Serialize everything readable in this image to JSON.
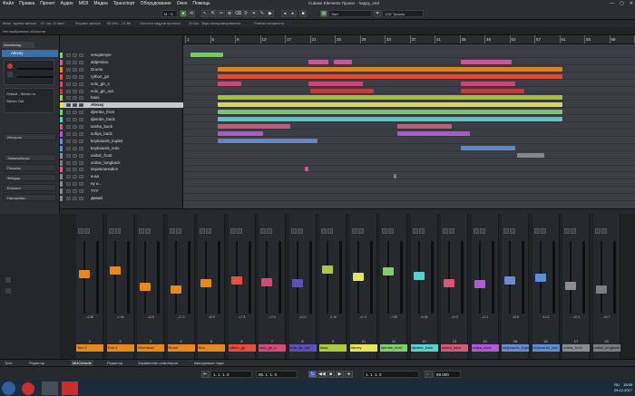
{
  "window": {
    "title": "Cubase Elements Проект - happy_end",
    "menu": [
      "Файл",
      "Правка",
      "Проект",
      "Аудио",
      "MIDI",
      "Медиа",
      "Транспорт",
      "Оборудование",
      "Окно",
      "Помощь"
    ],
    "controls": [
      "—",
      "▢",
      "✕"
    ]
  },
  "toolbar": {
    "mode": "M · S",
    "grid": "Такт",
    "quantize": "1/32 Триоль"
  },
  "info_line": {
    "items": [
      "Макс. время записи",
      "61 час 13 мин",
      "Формат записи",
      "96 kHz - 24 Bit",
      "Частота кадров проекта",
      "30 fps",
      "Звук панорамирования",
      "Равная мощность"
    ]
  },
  "status": "Нет выбранных объектов",
  "inspector": {
    "tab": "Инспектор",
    "track": "Alexey",
    "input": "Левый - Stereo In",
    "output": "Stereo Out",
    "sections": [
      "Инсерты",
      "Эквалайзеры",
      "Посылы",
      "Фейдер",
      "Блокнот",
      "Настройки"
    ],
    "colors": {
      "yellow": "#e6e45a",
      "green": "#6fcf5a",
      "blue": "#5b8fd6",
      "purple": "#8b6ab8",
      "cyan": "#5ccfd0"
    }
  },
  "tracks": [
    {
      "name": "vetuplenyie",
      "color": "#7fd06a"
    },
    {
      "name": "didjeridoo",
      "color": "#d65aa0"
    },
    {
      "name": "Drums",
      "color": "#e8891e"
    },
    {
      "name": "rython_gtr",
      "color": "#e84e3a"
    },
    {
      "name": "solo_gtr_s",
      "color": "#d64a7a"
    },
    {
      "name": "solo_gtr_out",
      "color": "#c93c3c"
    },
    {
      "name": "bass",
      "color": "#aec93c"
    },
    {
      "name": "Alexey",
      "color": "#e6e45a"
    },
    {
      "name": "djembe_front",
      "color": "#7fd06a"
    },
    {
      "name": "djembe_back",
      "color": "#5ccfd0"
    },
    {
      "name": "sasha_back",
      "color": "#d65a78"
    },
    {
      "name": "sofiya_back",
      "color": "#b45ad6"
    },
    {
      "name": "keyboards_kuplet",
      "color": "#6a8ad6"
    },
    {
      "name": "keyboards_solo",
      "color": "#5b8fd6"
    },
    {
      "name": "unitaz_front",
      "color": "#8a8e94"
    },
    {
      "name": "unitaz_longback",
      "color": "#7a7e84"
    },
    {
      "name": "переключайся",
      "color": "#d65aa0"
    },
    {
      "name": "а-аа",
      "color": "#888"
    },
    {
      "name": "ну и...",
      "color": "#888"
    },
    {
      "name": "ТУУ",
      "color": "#888"
    },
    {
      "name": "Давай",
      "color": "#888"
    }
  ],
  "ruler": [
    "1",
    "5",
    "9",
    "13",
    "17",
    "21",
    "25",
    "29",
    "33",
    "37",
    "41",
    "45",
    "49",
    "53",
    "57",
    "61",
    "65",
    "69",
    "73"
  ],
  "mixer": {
    "channels": [
      {
        "num": "1",
        "label": "Tom 2",
        "color": "#e8891e",
        "val": "-3.56",
        "level": 0.55
      },
      {
        "num": "2",
        "label": "Tom 4",
        "color": "#e8891e",
        "val": "-1.06",
        "level": 0.6
      },
      {
        "num": "3",
        "label": "Overhead",
        "color": "#e8891e",
        "val": "-12.8",
        "level": 0.35
      },
      {
        "num": "4",
        "label": "Room",
        "color": "#e8891e",
        "val": "-17.3",
        "level": 0.3
      },
      {
        "num": "5",
        "label": "Bus",
        "color": "#e8891e",
        "val": "-13.9",
        "level": 0.4
      },
      {
        "num": "6",
        "label": "rython_gtr",
        "color": "#e84e3a",
        "val": "-17.8",
        "level": 0.45
      },
      {
        "num": "7",
        "label": "solo_gtr_s",
        "color": "#d64a7a",
        "val": "-17.6",
        "level": 0.42
      },
      {
        "num": "8",
        "label": "solo_gtr_out",
        "color": "#5b4fb8",
        "val": "-12.0",
        "level": 0.4
      },
      {
        "num": "9",
        "label": "bass",
        "color": "#aec93c",
        "val": "-9.15",
        "level": 0.62
      },
      {
        "num": "10",
        "label": "Alexey",
        "color": "#e6e45a",
        "val": "-6.71",
        "level": 0.5
      },
      {
        "num": "11",
        "label": "djembe_front",
        "color": "#7fd06a",
        "val": "-7.65",
        "level": 0.58
      },
      {
        "num": "12",
        "label": "djembe_back",
        "color": "#5ccfd0",
        "val": "-6.35",
        "level": 0.52
      },
      {
        "num": "13",
        "label": "sasha_back",
        "color": "#d65a78",
        "val": "-12.0",
        "level": 0.4
      },
      {
        "num": "14",
        "label": "sofiya_back",
        "color": "#b45ad6",
        "val": "-12.1",
        "level": 0.38
      },
      {
        "num": "15",
        "label": "keyboards_kuplet",
        "color": "#6a8ad6",
        "val": "-13.5",
        "level": 0.45
      },
      {
        "num": "16",
        "label": "keyboards_solo",
        "color": "#5b8fd6",
        "val": "-11.6",
        "level": 0.48
      },
      {
        "num": "17",
        "label": "unitaz_front",
        "color": "#8a8e94",
        "val": "-12.4",
        "level": 0.36
      },
      {
        "num": "18",
        "label": "unitaz_longback",
        "color": "#7a7e84",
        "val": "-24.7",
        "level": 0.3
      }
    ]
  },
  "bottom_tabs": [
    "Трек",
    "Редактор",
    "MixConsole",
    "Редактор",
    "Управление семплером",
    "Аккордовые пэды"
  ],
  "transport": {
    "left_locator": "1. 1. 1. 0",
    "right_locator": "65. 1. 1. 0",
    "position": "1. 1. 1. 0",
    "tempo": "89.000"
  },
  "clock": {
    "time": "15:55",
    "date": "29.12.2017",
    "lang": "RU"
  }
}
